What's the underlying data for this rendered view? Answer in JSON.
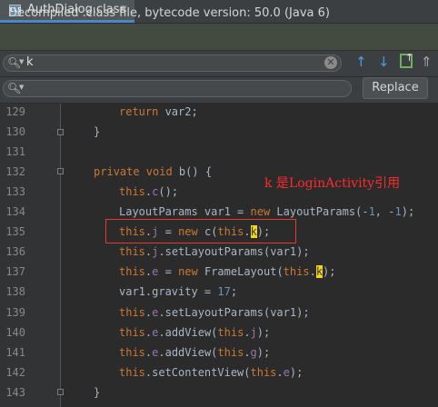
{
  "tab": {
    "icon_text": "CLS",
    "title": "AuthDialog.class",
    "close": "✕"
  },
  "banner": {
    "text": "Decompiled .class file, bytecode version: 50.0 (Java 6)"
  },
  "find": {
    "value": "k",
    "clear_glyph": "✕"
  },
  "toolbar": {
    "up": "🡑",
    "down": "🡓",
    "more": "⇧"
  },
  "replace": {
    "button_label": "Replace"
  },
  "editor": {
    "lines": [
      {
        "no": "129",
        "segs": [
          [
            "kw",
            "return "
          ],
          [
            "",
            "var2;"
          ]
        ]
      },
      {
        "no": "130",
        "segs": [
          [
            "",
            "}"
          ]
        ]
      },
      {
        "no": "131",
        "segs": []
      },
      {
        "no": "132",
        "segs": [
          [
            "kw",
            "private void "
          ],
          [
            "",
            "b() {"
          ]
        ]
      },
      {
        "no": "133",
        "segs": [
          [
            "kw",
            "this"
          ],
          [
            "",
            "."
          ],
          [
            "fld",
            "c"
          ],
          [
            "",
            "();"
          ]
        ]
      },
      {
        "no": "134",
        "segs": [
          [
            "",
            "LayoutParams var1 = "
          ],
          [
            "kw",
            "new "
          ],
          [
            "",
            "LayoutParams(-"
          ],
          [
            "num",
            "1"
          ],
          [
            "",
            ", -"
          ],
          [
            "num",
            "1"
          ],
          [
            "",
            ");"
          ]
        ]
      },
      {
        "no": "135",
        "segs": [
          [
            "kw",
            "this"
          ],
          [
            "",
            "."
          ],
          [
            "fld",
            "j"
          ],
          [
            "",
            " = "
          ],
          [
            "kw",
            "new "
          ],
          [
            "",
            "c("
          ],
          [
            "kw",
            "this"
          ],
          [
            "",
            "."
          ],
          [
            "hlk",
            "k"
          ],
          [
            "",
            ");"
          ]
        ]
      },
      {
        "no": "136",
        "segs": [
          [
            "kw",
            "this"
          ],
          [
            "",
            "."
          ],
          [
            "fld",
            "j"
          ],
          [
            "",
            ".setLayoutParams(var1);"
          ]
        ]
      },
      {
        "no": "137",
        "segs": [
          [
            "kw",
            "this"
          ],
          [
            "",
            "."
          ],
          [
            "fld",
            "e"
          ],
          [
            "",
            " = "
          ],
          [
            "kw",
            "new "
          ],
          [
            "",
            "FrameLayout("
          ],
          [
            "kw",
            "this"
          ],
          [
            "",
            "."
          ],
          [
            "hlk",
            "k"
          ],
          [
            "",
            ");"
          ]
        ]
      },
      {
        "no": "138",
        "segs": [
          [
            "",
            "var1.gravity = "
          ],
          [
            "num",
            "17"
          ],
          [
            "",
            ";"
          ]
        ]
      },
      {
        "no": "139",
        "segs": [
          [
            "kw",
            "this"
          ],
          [
            "",
            "."
          ],
          [
            "fld",
            "e"
          ],
          [
            "",
            ".setLayoutParams(var1);"
          ]
        ]
      },
      {
        "no": "140",
        "segs": [
          [
            "kw",
            "this"
          ],
          [
            "",
            "."
          ],
          [
            "fld",
            "e"
          ],
          [
            "",
            ".addView("
          ],
          [
            "kw",
            "this"
          ],
          [
            "",
            "."
          ],
          [
            "fld",
            "j"
          ],
          [
            "",
            ");"
          ]
        ]
      },
      {
        "no": "141",
        "segs": [
          [
            "kw",
            "this"
          ],
          [
            "",
            "."
          ],
          [
            "fld",
            "e"
          ],
          [
            "",
            ".addView("
          ],
          [
            "kw",
            "this"
          ],
          [
            "",
            "."
          ],
          [
            "fld",
            "g"
          ],
          [
            "",
            ");"
          ]
        ]
      },
      {
        "no": "142",
        "segs": [
          [
            "kw",
            "this"
          ],
          [
            "",
            ".setContentView("
          ],
          [
            "kw",
            "this"
          ],
          [
            "",
            "."
          ],
          [
            "fld",
            "e"
          ],
          [
            "",
            ");"
          ]
        ]
      },
      {
        "no": "143",
        "segs": [
          [
            "",
            "}"
          ]
        ]
      }
    ]
  },
  "annotation": {
    "text": "k 是LoginActivity引用"
  }
}
